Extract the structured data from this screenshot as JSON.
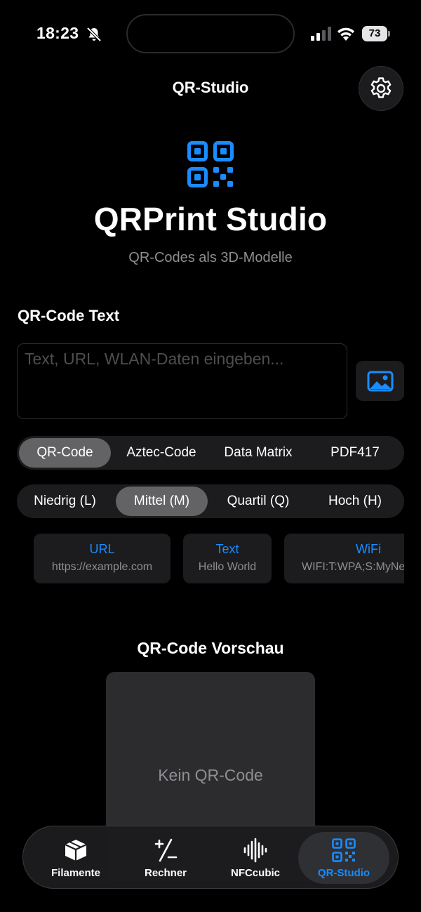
{
  "status_bar": {
    "time": "18:23",
    "battery": "73"
  },
  "nav": {
    "title": "QR-Studio"
  },
  "hero": {
    "title": "QRPrint Studio",
    "subtitle": "QR-Codes als 3D-Modelle"
  },
  "input": {
    "label": "QR-Code Text",
    "placeholder": "Text, URL, WLAN-Daten eingeben...",
    "value": ""
  },
  "code_types": {
    "selected": "QR-Code",
    "items": [
      "QR-Code",
      "Aztec-Code",
      "Data Matrix",
      "PDF417"
    ]
  },
  "error_correction": {
    "selected": "Mittel (M)",
    "items": [
      "Niedrig (L)",
      "Mittel (M)",
      "Quartil (Q)",
      "Hoch (H)"
    ]
  },
  "templates": [
    {
      "title": "URL",
      "example": "https://example.com"
    },
    {
      "title": "Text",
      "example": "Hello World"
    },
    {
      "title": "WiFi",
      "example": "WIFI:T:WPA;S:MyNetwork;"
    }
  ],
  "preview": {
    "title": "QR-Code Vorschau",
    "empty_text": "Kein QR-Code"
  },
  "tabs": {
    "selected": "QR-Studio",
    "items": [
      {
        "label": "Filamente",
        "icon": "cube-icon"
      },
      {
        "label": "Rechner",
        "icon": "plus-minus-icon"
      },
      {
        "label": "NFCcubic",
        "icon": "waveform-icon"
      },
      {
        "label": "QR-Studio",
        "icon": "qrcode-icon"
      }
    ]
  },
  "colors": {
    "accent": "#1A8CFF",
    "background": "#000000",
    "surface": "#1C1C1E",
    "selected_segment": "#636366"
  }
}
